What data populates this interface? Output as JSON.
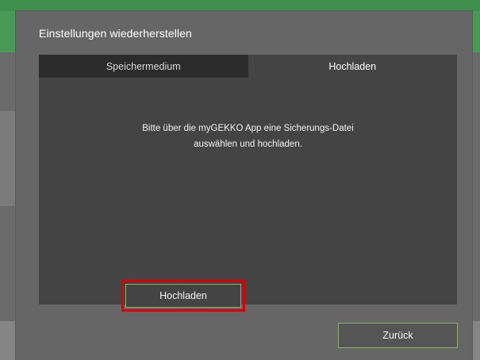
{
  "dialog": {
    "title": "Einstellungen wiederherstellen",
    "tabs": [
      {
        "label": "Speichermedium",
        "active": false
      },
      {
        "label": "Hochladen",
        "active": true
      }
    ],
    "message_line1": "Bitte über die myGEKKO App eine Sicherungs-Datei",
    "message_line2": "auswählen und hochladen.",
    "upload_button_label": "Hochladen",
    "back_button_label": "Zurück"
  },
  "colors": {
    "accent_border": "#8fb06a",
    "highlight": "#e00000",
    "brand_green": "#3e8e4c"
  }
}
